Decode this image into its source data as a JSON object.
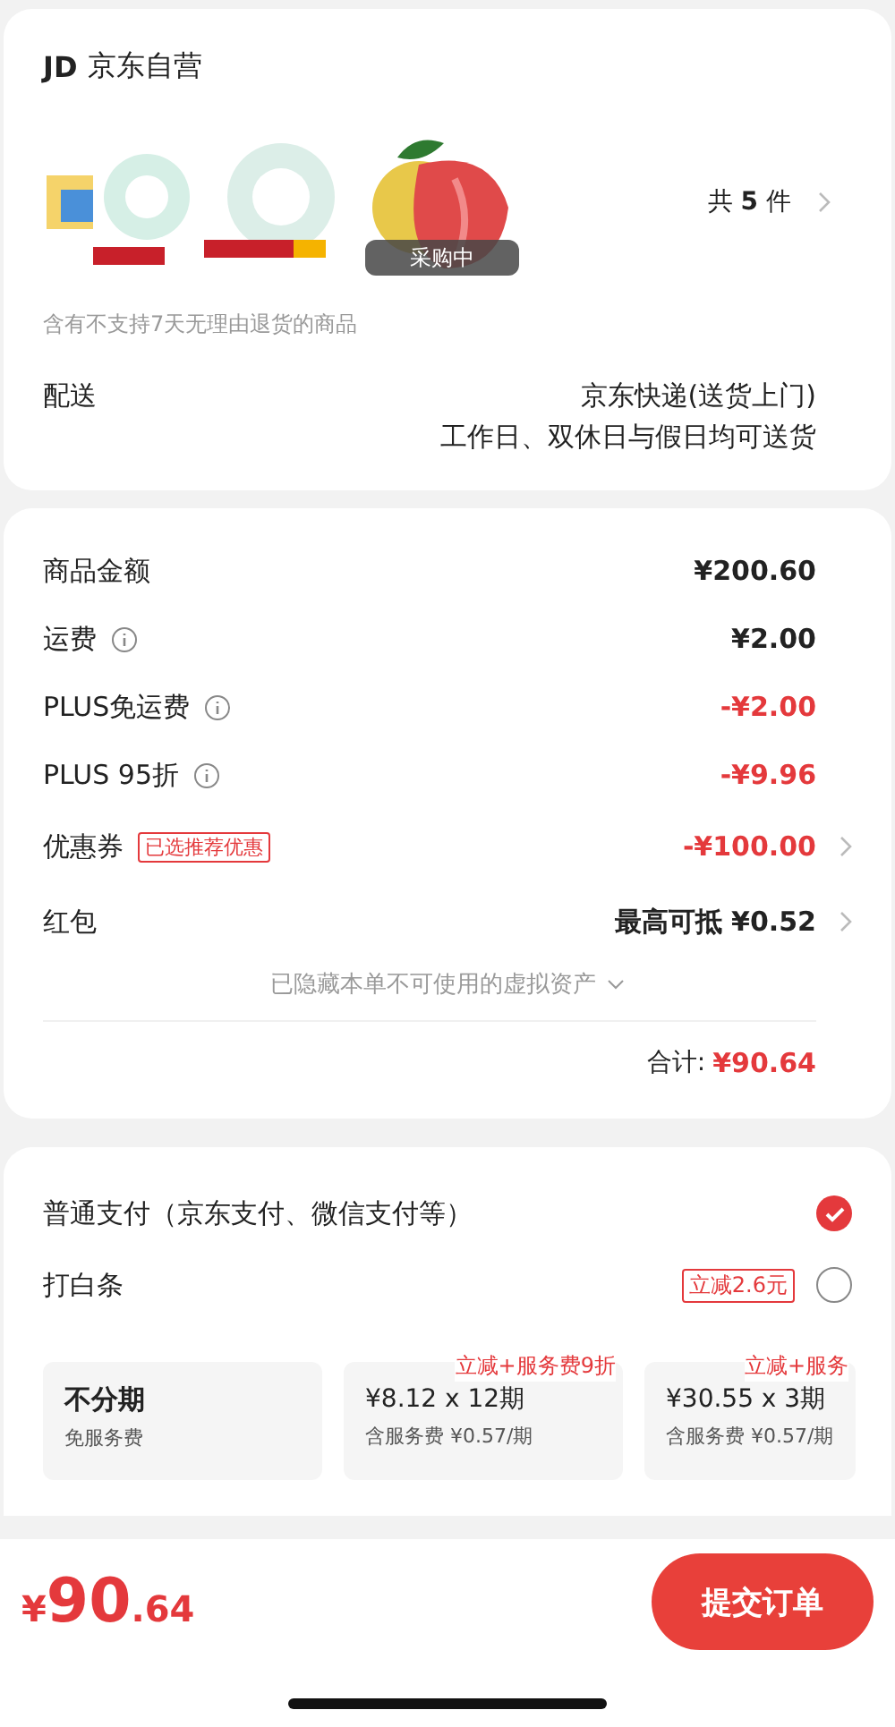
{
  "shop": {
    "logo": "JD",
    "name": "京东自营",
    "images": [
      {
        "kind": "picture"
      },
      {
        "kind": "picture"
      },
      {
        "kind": "picture",
        "badge": "采购中"
      }
    ],
    "count_prefix": "共",
    "count": "5",
    "count_suffix": "件",
    "notice": "含有不支持7天无理由退货的商品",
    "delivery": {
      "label": "配送",
      "lines": [
        "京东快递(送货上门)",
        "工作日、双休日与假日均可送货"
      ]
    }
  },
  "costs": {
    "rows": [
      {
        "label": "商品金额",
        "info": false,
        "value": "¥200.60",
        "discount": false,
        "arrow": false
      },
      {
        "label": "运费",
        "info": true,
        "value": "¥2.00",
        "discount": false,
        "arrow": false
      },
      {
        "label": "PLUS免运费",
        "info": true,
        "value": "-¥2.00",
        "discount": true,
        "arrow": false
      },
      {
        "label": "PLUS 95折",
        "info": true,
        "value": "-¥9.96",
        "discount": true,
        "arrow": false
      },
      {
        "label": "优惠券",
        "info": false,
        "tag": "已选推荐优惠",
        "value": "-¥100.00",
        "discount": true,
        "arrow": true
      },
      {
        "label": "红包",
        "info": false,
        "value": "最高可抵 ¥0.52",
        "discount": false,
        "arrow": true
      }
    ],
    "hidden_note": "已隐藏本单不可使用的虚拟资产",
    "total_label": "合计:",
    "total": "¥90.64"
  },
  "payment": {
    "methods": [
      {
        "label": "普通支付（京东支付、微信支付等）",
        "selected": true
      },
      {
        "label": "打白条",
        "tag": "立减2.6元",
        "selected": false
      }
    ],
    "plans": [
      {
        "title": "不分期",
        "subtitle": "免服务费"
      },
      {
        "tag": "立减+服务费9折",
        "title": "¥8.12 x 12期",
        "subtitle": "含服务费 ¥0.57/期"
      },
      {
        "tag": "立减+服务",
        "title": "¥30.55 x 3期",
        "subtitle": "含服务费 ¥0.57/期"
      }
    ]
  },
  "footer": {
    "currency": "¥",
    "amount": "90",
    "cents": ".64",
    "submit": "提交订单"
  }
}
